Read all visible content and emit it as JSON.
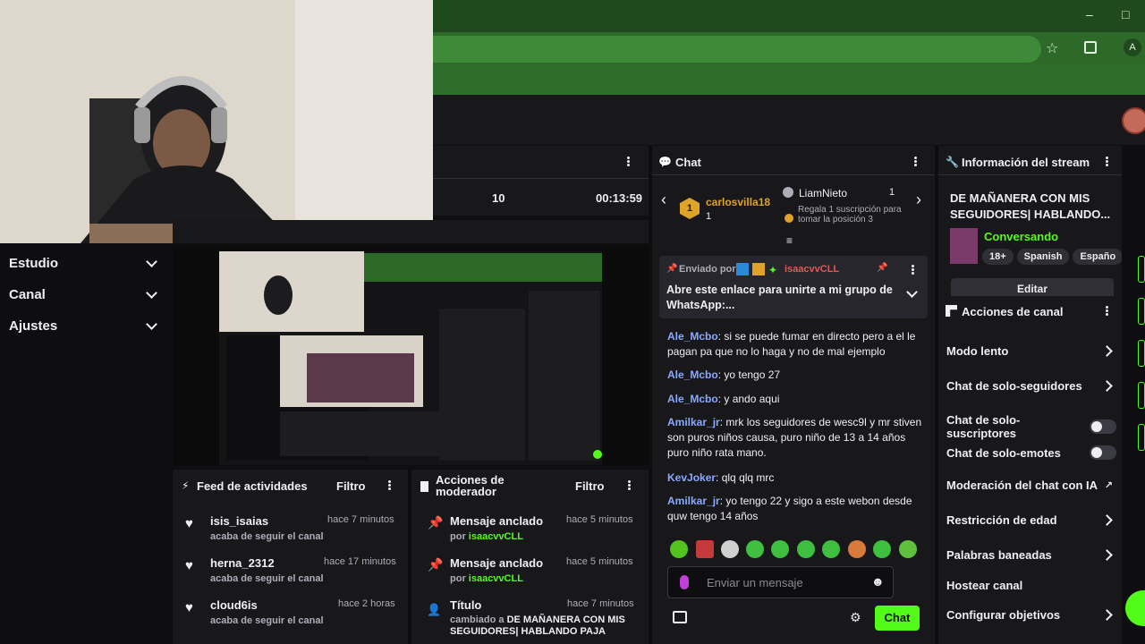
{
  "browser": {
    "star_icon": "star-icon",
    "ext_icon": "puzzle-icon",
    "profile_initial": "A",
    "win_min": "–",
    "win_max": "□"
  },
  "sidebar": {
    "items": [
      {
        "label": "Estudio"
      },
      {
        "label": "Canal"
      },
      {
        "label": "Ajustes"
      }
    ]
  },
  "stats": {
    "viewers": "10",
    "uptime": "00:13:59"
  },
  "activity_feed": {
    "title": "Feed de actividades",
    "filter": "Filtro",
    "items": [
      {
        "user": "isis_isaias",
        "action": "acaba de seguir el canal",
        "time": "hace 7 minutos"
      },
      {
        "user": "herna_2312",
        "action": "acaba de seguir el canal",
        "time": "hace 17 minutos"
      },
      {
        "user": "cloud6is",
        "action": "acaba de seguir el canal",
        "time": "hace 2 horas"
      }
    ]
  },
  "mod_actions": {
    "title": "Acciones de moderador",
    "filter": "Filtro",
    "items": [
      {
        "title": "Mensaje anclado",
        "by_prefix": "por ",
        "by_user": "isaacvvCLL",
        "time": "hace 5 minutos"
      },
      {
        "title": "Mensaje anclado",
        "by_prefix": "por ",
        "by_user": "isaacvvCLL",
        "time": "hace 5 minutos"
      },
      {
        "title": "Título",
        "by_prefix": "cambiado a ",
        "by_user": "DE MAÑANERA CON MIS SEGUIDORES| HABLANDO PAJA",
        "time": "hace 7 minutos"
      }
    ]
  },
  "chat": {
    "title": "Chat",
    "leader_user": "carlosvilla18",
    "leader_count": "1",
    "leader_rank": "1",
    "gift_user": "LiamNieto",
    "gift_count": "1",
    "gift_text": "Regala 1 suscripción para tomar la posición 3",
    "pinned_by_label": "Enviado por",
    "pinned_user": "isaacvvCLL",
    "pinned_text": "Abre este enlace para unirte a mi grupo de WhatsApp:...",
    "messages": [
      {
        "user": "Ale_Mcbo",
        "text": ": si se puede fumar en directo pero a el le pagan pa que no lo haga y no de mal ejemplo"
      },
      {
        "user": "Ale_Mcbo",
        "text": ": yo tengo 27"
      },
      {
        "user": "Ale_Mcbo",
        "text": ": y ando aqui"
      },
      {
        "user": "Amilkar_jr",
        "text": ": mrk los seguidores de wesc9l y mr stiven son puros niños causa, puro niño de 13 a 14 años puro niño rata mano."
      },
      {
        "user": "KevJoker",
        "text": ": qlq qlq mrc"
      },
      {
        "user": "Amilkar_jr",
        "text": ": yo tengo 22 y sigo a este webon desde quw tengo 14 años"
      }
    ],
    "input_placeholder": "Enviar un mensaje",
    "send_label": "Chat"
  },
  "stream_info": {
    "title": "Información del stream",
    "stream_title": "DE MAÑANERA CON MIS SEGUIDORES| HABLANDO...",
    "category": "Conversando",
    "tags": [
      "18+",
      "Spanish",
      "Españo"
    ],
    "edit_label": "Editar"
  },
  "channel_actions": {
    "title": "Acciones de canal",
    "items": [
      {
        "label": "Modo lento"
      },
      {
        "label": "Chat de solo-seguidores"
      },
      {
        "label": "Chat de solo-suscriptores"
      },
      {
        "label": "Chat de solo-emotes"
      },
      {
        "label": "Moderación del chat con IA"
      },
      {
        "label": "Restricción de edad"
      },
      {
        "label": "Palabras baneadas"
      },
      {
        "label": "Hostear canal"
      },
      {
        "label": "Configurar objetivos"
      }
    ]
  },
  "colors": {
    "accent_green": "#53fc18",
    "panel": "#18181b",
    "bg": "#0e0e10",
    "user_blue": "#8aa8ff"
  }
}
